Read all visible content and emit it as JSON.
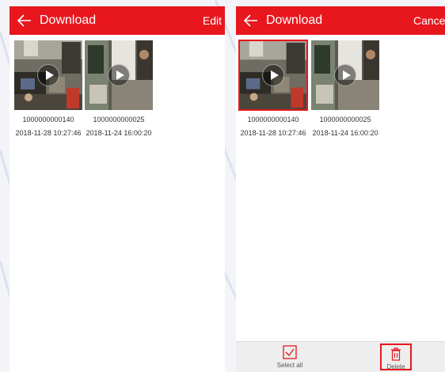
{
  "left_screen": {
    "header": {
      "title": "Download",
      "action_label": "Edit"
    },
    "items": [
      {
        "name": "1000000000140",
        "date": "2018-11-28 10:27:46",
        "selected": false
      },
      {
        "name": "1000000000025",
        "date": "2018-11-24 16:00:20",
        "selected": false
      }
    ]
  },
  "right_screen": {
    "header": {
      "title": "Download",
      "action_label": "Cancel"
    },
    "items": [
      {
        "name": "1000000000140",
        "date": "2018-11-28 10:27:46",
        "selected": true
      },
      {
        "name": "1000000000025",
        "date": "2018-11-24 16:00:20",
        "selected": false
      }
    ],
    "bottom_bar": {
      "select_all_label": "Select all",
      "delete_label": "Delete"
    }
  },
  "colors": {
    "accent": "#e8171e",
    "background": "#ffffff",
    "page_background": "#f3f4f8"
  },
  "icons": [
    "back-arrow-icon",
    "play-icon",
    "checkbox-icon",
    "trash-icon"
  ]
}
